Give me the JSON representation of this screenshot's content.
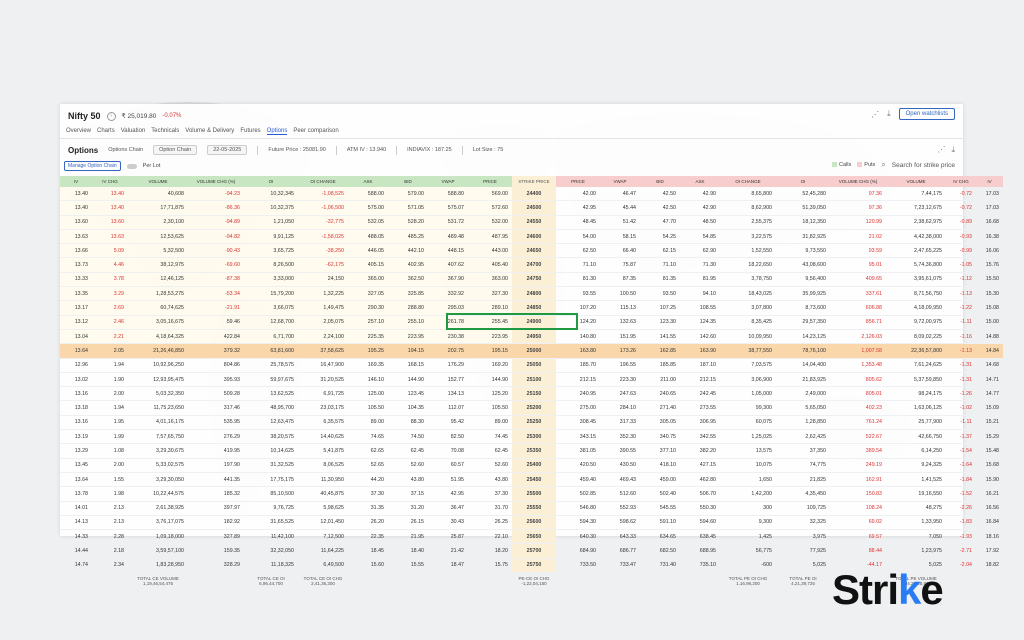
{
  "header": {
    "title": "Nifty 50",
    "price": "₹ 25,019.80",
    "change": "-0.07%",
    "watchlist": "Open watchlists"
  },
  "nav": [
    "Overview",
    "Charts",
    "Valuation",
    "Technicals",
    "Volume & Delivery",
    "Futures",
    "Options",
    "Peer comparison"
  ],
  "options": {
    "title": "Options",
    "tab1": "Options Chain",
    "tab2": "Option Chain",
    "date": "22-05-2025",
    "future": "Future Price : 25081.90",
    "atm": "ATM IV : 13.940",
    "indiavix": "INDIAVIX : 187.25",
    "lot": "Lot Size : 75"
  },
  "controls": {
    "manage": "Manage Option Chain",
    "perlot": "Per Lot",
    "calls": "Calls",
    "puts": "Puts",
    "search": "Search for strike price"
  },
  "columns": {
    "calls": [
      "IV",
      "IV CHG",
      "VOLUME",
      "VOLUME CHG (%)",
      "OI",
      "OI CHANGE",
      "ASK",
      "BID",
      "VWAP",
      "PRICE"
    ],
    "strike": "STRIKE PRICE",
    "puts": [
      "PRICE",
      "VWAP",
      "BID",
      "ASK",
      "OI CHANGE",
      "OI",
      "VOLUME CHG (%)",
      "VOLUME",
      "IV CHG",
      "IV"
    ]
  },
  "rows": [
    {
      "c": [
        "13.40",
        "13.40",
        "40,608",
        "-94.23",
        "10,32,345",
        "-1,08,525",
        "588.00",
        "579.00",
        "588.80",
        "569.00"
      ],
      "s": "24400",
      "p": [
        "42.00",
        "46.47",
        "42.50",
        "42.90",
        "8,65,800",
        "52,45,280",
        "97.36",
        "7,44,175",
        "-0.72",
        "17.03"
      ]
    },
    {
      "c": [
        "13.40",
        "13.40",
        "17,71,875",
        "-86.36",
        "10,32,375",
        "-1,06,500",
        "575.00",
        "571.05",
        "575.07",
        "572.60"
      ],
      "s": "24500",
      "p": [
        "42.95",
        "45.44",
        "42.50",
        "42.90",
        "8,62,900",
        "51,39,050",
        "97.36",
        "7,23,12,675",
        "-0.72",
        "17.03"
      ]
    },
    {
      "c": [
        "13.60",
        "13.60",
        "2,30,100",
        "-94.89",
        "1,21,050",
        "-32,775",
        "532.05",
        "528.20",
        "531.72",
        "532.00"
      ],
      "s": "24550",
      "p": [
        "48.45",
        "51.42",
        "47.70",
        "48.50",
        "2,55,375",
        "18,12,350",
        "120.99",
        "2,38,62,975",
        "-0.89",
        "16.68"
      ]
    },
    {
      "c": [
        "13.63",
        "13.63",
        "12,53,625",
        "-94.82",
        "9,91,125",
        "-1,58,025",
        "488.05",
        "485.25",
        "489.48",
        "487.95"
      ],
      "s": "24600",
      "p": [
        "54.00",
        "58.15",
        "54.25",
        "54.85",
        "3,22,575",
        "31,82,925",
        "21.02",
        "4,42,38,000",
        "-0.93",
        "16.38"
      ]
    },
    {
      "c": [
        "13.66",
        "5.09",
        "5,32,500",
        "-90.43",
        "3,65,725",
        "-38,250",
        "446.05",
        "442.10",
        "448.15",
        "443.00"
      ],
      "s": "24650",
      "p": [
        "62.50",
        "66.40",
        "62.15",
        "62.90",
        "1,52,550",
        "9,73,550",
        "93.59",
        "2,47,65,225",
        "-0.99",
        "16.06"
      ]
    },
    {
      "c": [
        "13.73",
        "4.46",
        "38,12,975",
        "-69.60",
        "8,26,500",
        "-62,175",
        "405.15",
        "402.95",
        "407.62",
        "405.40"
      ],
      "s": "24700",
      "p": [
        "71.10",
        "75.87",
        "71.10",
        "71.30",
        "18,22,650",
        "43,08,600",
        "95.01",
        "5,74,36,800",
        "-1.05",
        "15.76"
      ]
    },
    {
      "c": [
        "13.33",
        "3.78",
        "12,46,125",
        "-87.38",
        "3,33,000",
        "24,150",
        "365.00",
        "362.50",
        "367.90",
        "363.00"
      ],
      "s": "24750",
      "p": [
        "81.30",
        "87.35",
        "81.35",
        "81.95",
        "3,78,750",
        "9,56,400",
        "409.65",
        "3,95,61,075",
        "-1.12",
        "15.50"
      ]
    },
    {
      "c": [
        "13.35",
        "3.29",
        "1,28,53,275",
        "-53.34",
        "15,79,200",
        "1,32,225",
        "327.05",
        "325.85",
        "332.92",
        "327.30"
      ],
      "s": "24800",
      "p": [
        "93.55",
        "100.50",
        "93.50",
        "94.10",
        "18,43,025",
        "35,99,925",
        "337.61",
        "8,71,56,750",
        "-1.13",
        "15.30"
      ]
    },
    {
      "c": [
        "13.17",
        "2.69",
        "60,74,625",
        "-21.91",
        "3,66,075",
        "1,49,475",
        "290.30",
        "288.80",
        "295.03",
        "289.10"
      ],
      "s": "24850",
      "p": [
        "107.20",
        "115.13",
        "107.25",
        "108.55",
        "3,07,800",
        "8,73,600",
        "606.88",
        "4,18,09,950",
        "-1.22",
        "15.08"
      ]
    },
    {
      "c": [
        "13.12",
        "2.46",
        "3,05,16,675",
        "59.46",
        "12,68,700",
        "2,05,075",
        "257.10",
        "255.10",
        "261.78",
        "255.45"
      ],
      "s": "24900",
      "p": [
        "124.20",
        "132.63",
        "123.30",
        "124.35",
        "8,35,425",
        "29,57,350",
        "856.71",
        "9,72,00,975",
        "-1.11",
        "15.00"
      ]
    },
    {
      "c": [
        "13.04",
        "2.21",
        "4,18,64,325",
        "422.84",
        "6,71,700",
        "2,24,100",
        "225.35",
        "223.95",
        "230.38",
        "223.95"
      ],
      "s": "24950",
      "p": [
        "140.80",
        "151.95",
        "141.55",
        "142.60",
        "10,09,950",
        "14,23,125",
        "2,126.03",
        "8,09,02,225",
        "-1.16",
        "14.88"
      ]
    },
    {
      "c": [
        "13.64",
        "2.05",
        "21,26,46,850",
        "379.32",
        "63,81,600",
        "37,58,625",
        "195.25",
        "194.15",
        "202.75",
        "195.15"
      ],
      "s": "25000",
      "p": [
        "163.80",
        "173.26",
        "162.85",
        "163.90",
        "38,77,550",
        "78,76,100",
        "1,007.58",
        "22,36,57,800",
        "-1.13",
        "14.84"
      ],
      "atm": true
    },
    {
      "c": [
        "12.96",
        "1.94",
        "10,92,96,250",
        "804.86",
        "25,78,575",
        "16,47,900",
        "169.35",
        "168.15",
        "176.29",
        "169.20"
      ],
      "s": "25050",
      "p": [
        "185.70",
        "196.55",
        "185.85",
        "187.10",
        "7,03,575",
        "14,04,400",
        "1,353.48",
        "7,61,24,625",
        "-1.31",
        "14.68"
      ]
    },
    {
      "c": [
        "13.02",
        "1.90",
        "12,93,95,475",
        "395.93",
        "59,97,675",
        "31,20,525",
        "146.10",
        "144.90",
        "152.77",
        "144.90"
      ],
      "s": "25100",
      "p": [
        "212.15",
        "223.30",
        "211.00",
        "212.15",
        "3,06,900",
        "21,83,925",
        "805.62",
        "5,37,59,850",
        "-1.31",
        "14.71"
      ]
    },
    {
      "c": [
        "13.16",
        "2.00",
        "5,03,32,350",
        "509.28",
        "13,62,525",
        "6,91,725",
        "125.00",
        "123.45",
        "134.13",
        "125.20"
      ],
      "s": "25150",
      "p": [
        "240.95",
        "247.63",
        "240.65",
        "242.45",
        "1,05,000",
        "2,49,000",
        "805.01",
        "98,24,175",
        "-1.26",
        "14.77"
      ]
    },
    {
      "c": [
        "13.18",
        "1.94",
        "11,75,23,650",
        "317.46",
        "48,95,700",
        "23,03,175",
        "105.50",
        "104.35",
        "112.07",
        "105.50"
      ],
      "s": "25200",
      "p": [
        "275.00",
        "284.10",
        "271.40",
        "273.55",
        "99,300",
        "5,65,050",
        "402.23",
        "1,63,06,125",
        "-1.02",
        "15.09"
      ]
    },
    {
      "c": [
        "13.16",
        "1.95",
        "4,01,16,175",
        "535.95",
        "12,63,475",
        "6,35,575",
        "89.00",
        "88.30",
        "95.42",
        "89.00"
      ],
      "s": "25250",
      "p": [
        "308.45",
        "317.33",
        "305.05",
        "306.95",
        "60,075",
        "1,28,850",
        "761.24",
        "25,77,900",
        "-1.11",
        "15.21"
      ]
    },
    {
      "c": [
        "13.19",
        "1.99",
        "7,57,65,750",
        "276.29",
        "38,20,575",
        "14,40,625",
        "74.65",
        "74.50",
        "82.50",
        "74.45"
      ],
      "s": "25300",
      "p": [
        "343.15",
        "352.30",
        "340.75",
        "342.55",
        "1,25,025",
        "2,62,425",
        "522.67",
        "42,66,750",
        "-1.37",
        "15.29"
      ]
    },
    {
      "c": [
        "13.29",
        "1.08",
        "3,29,30,675",
        "419.95",
        "10,14,625",
        "5,41,875",
        "62.65",
        "62.45",
        "70.08",
        "62.45"
      ],
      "s": "25350",
      "p": [
        "381.05",
        "390.55",
        "377.10",
        "382.20",
        "13,575",
        "37,350",
        "389.54",
        "6,14,250",
        "-1.54",
        "15.48"
      ]
    },
    {
      "c": [
        "13.45",
        "2.00",
        "5,33,02,575",
        "197.90",
        "31,32,525",
        "8,06,525",
        "52.65",
        "52.60",
        "60.57",
        "52.60"
      ],
      "s": "25400",
      "p": [
        "420.50",
        "430.50",
        "418.10",
        "427.15",
        "10,075",
        "74,775",
        "249.19",
        "9,24,325",
        "-1.64",
        "15.68"
      ]
    },
    {
      "c": [
        "13.64",
        "1.55",
        "3,29,30,050",
        "441.35",
        "17,75,175",
        "11,30,950",
        "44.20",
        "43.80",
        "51.95",
        "43.80"
      ],
      "s": "25450",
      "p": [
        "459.40",
        "469.43",
        "459.00",
        "462.80",
        "1,650",
        "21,825",
        "162.91",
        "1,41,525",
        "-1.84",
        "15.90"
      ]
    },
    {
      "c": [
        "13.78",
        "1.98",
        "10,22,44,575",
        "185.32",
        "85,10,500",
        "40,45,875",
        "37.30",
        "37.15",
        "42.95",
        "37.30"
      ],
      "s": "25500",
      "p": [
        "502.85",
        "512.60",
        "502.40",
        "506.70",
        "1,42,200",
        "4,35,450",
        "150.83",
        "19,16,550",
        "-1.52",
        "16.21"
      ]
    },
    {
      "c": [
        "14.01",
        "2.13",
        "2,61,38,925",
        "397.97",
        "9,76,725",
        "5,98,625",
        "31.35",
        "31.20",
        "36.47",
        "31.70"
      ],
      "s": "25550",
      "p": [
        "546.80",
        "552.93",
        "545.55",
        "550.30",
        "300",
        "109,725",
        "108.24",
        "48,275",
        "-2.26",
        "16.56"
      ]
    },
    {
      "c": [
        "14.13",
        "2.13",
        "3,76,17,075",
        "182.92",
        "31,65,525",
        "12,01,450",
        "26.20",
        "26.15",
        "30.43",
        "26.25"
      ],
      "s": "25600",
      "p": [
        "594.30",
        "598.62",
        "591.10",
        "594.60",
        "9,300",
        "32,325",
        "69.02",
        "1,33,950",
        "-1.83",
        "16.84"
      ]
    },
    {
      "c": [
        "14.33",
        "2.28",
        "1,09,18,000",
        "327.89",
        "11,42,100",
        "7,12,500",
        "22.35",
        "21.95",
        "25.87",
        "22.10"
      ],
      "s": "25650",
      "p": [
        "640.30",
        "643.33",
        "634.65",
        "638.45",
        "1,425",
        "3,975",
        "69.57",
        "7,050",
        "-1.93",
        "18.16"
      ]
    },
    {
      "c": [
        "14.44",
        "2.18",
        "3,59,57,100",
        "159.35",
        "32,32,050",
        "11,64,225",
        "18.45",
        "18.40",
        "21.42",
        "18.20"
      ],
      "s": "25700",
      "p": [
        "684.90",
        "686.77",
        "682.50",
        "688.95",
        "56,775",
        "77,925",
        "88.44",
        "1,23,975",
        "-2.71",
        "17.92"
      ]
    },
    {
      "c": [
        "14.74",
        "2.34",
        "1,83,28,950",
        "328.29",
        "11,18,325",
        "6,49,500",
        "15.60",
        "15.55",
        "18.47",
        "15.75"
      ],
      "s": "25750",
      "p": [
        "733.50",
        "733.47",
        "731.40",
        "735.10",
        "-600",
        "5,025",
        "-44.17",
        "5,025",
        "-2.04",
        "18.82"
      ]
    }
  ],
  "footer": {
    "ce_volume_label": "TOTAL CE VOLUME",
    "ce_volume": "1,19,46,54,475",
    "ce_oi_label": "TOTAL CE OI",
    "ce_oi": "6,96,44,700",
    "ce_oichg_label": "TOTAL CE OI CHG",
    "ce_oichg": "2,41,36,300",
    "pcr_label": "PE-CE OI CHG",
    "pcr": "-1,22,04,150",
    "pe_oichg_label": "TOTAL PE OI CHG",
    "pe_oichg": "1,16,96,200",
    "pe_oi_label": "TOTAL PE OI",
    "pe_oi": "4,21,39,725",
    "pe_volume_label": "TOTAL PE VOLUME",
    "pe_volume": "1,04,27,28,875"
  },
  "logo": {
    "prefix": "Stri",
    "accent": "k",
    "suffix": "e"
  },
  "colors": {
    "calls": "#c9e6c2",
    "puts": "#f8cdcd",
    "atm": "#fad7ab",
    "accent": "#2a7cf6"
  }
}
